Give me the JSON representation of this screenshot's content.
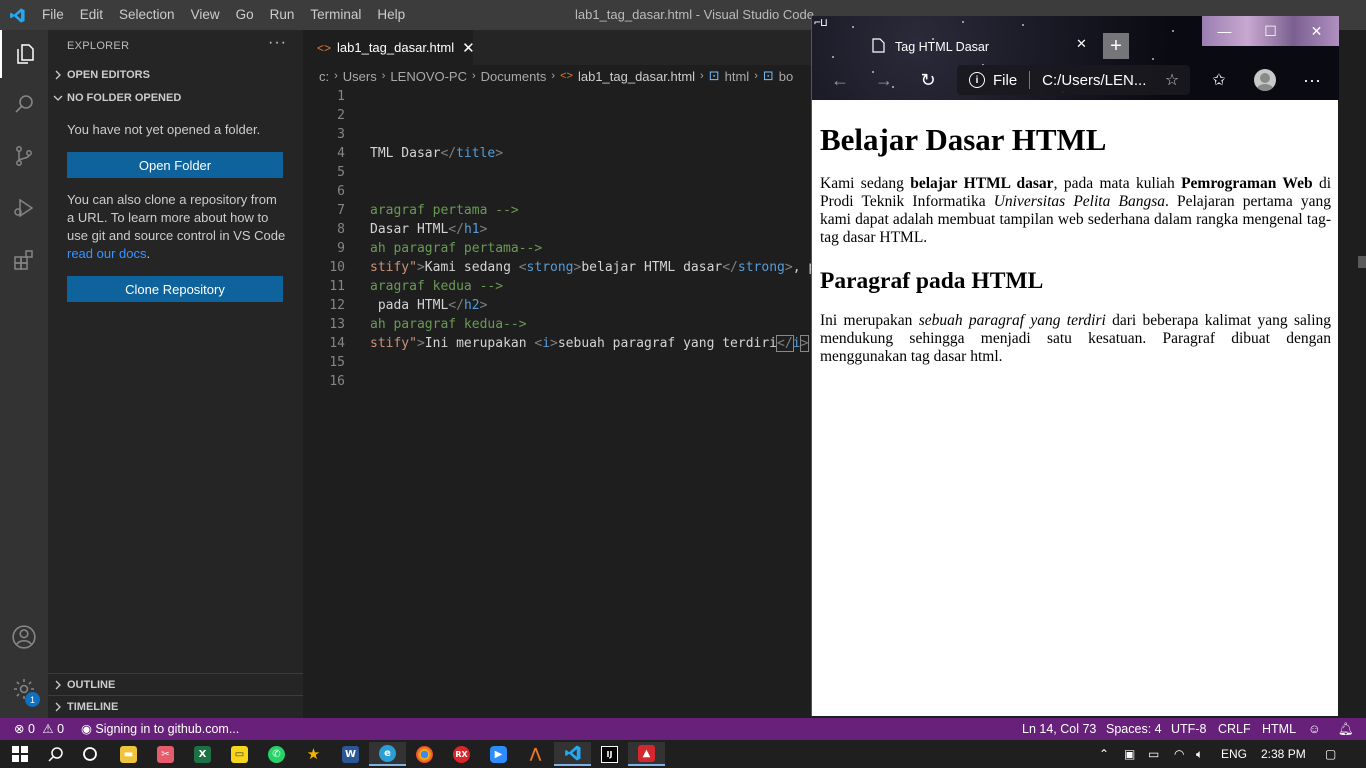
{
  "titlebar": {
    "menu": [
      "File",
      "Edit",
      "Selection",
      "View",
      "Go",
      "Run",
      "Terminal",
      "Help"
    ],
    "window_title": "lab1_tag_dasar.html - Visual Studio Code"
  },
  "activitybar": {
    "items": [
      "explorer-icon",
      "search-icon",
      "source-control-icon",
      "run-debug-icon",
      "extensions-icon",
      "accounts-icon",
      "manage-gear-icon"
    ],
    "badge": "1"
  },
  "sidebar": {
    "title": "EXPLORER",
    "more": "···",
    "open_editors": "OPEN EDITORS",
    "no_folder": "NO FOLDER OPENED",
    "no_folder_text": "You have not yet opened a folder.",
    "open_folder_button": "Open Folder",
    "clone_text_before": "You can also clone a repository from a URL. To learn more about how to use git and source control in VS Code ",
    "clone_link": "read our docs",
    "clone_text_after": ".",
    "clone_button": "Clone Repository",
    "outline": "OUTLINE",
    "timeline": "TIMELINE"
  },
  "editor": {
    "tab_label": "lab1_tag_dasar.html",
    "tab_close": "✕",
    "breadcrumbs": [
      "c:",
      "Users",
      "LENOVO-PC",
      "Documents",
      "lab1_tag_dasar.html",
      "html",
      "bo"
    ],
    "line_numbers": [
      "1",
      "2",
      "3",
      "4",
      "5",
      "6",
      "7",
      "8",
      "9",
      "10",
      "11",
      "12",
      "13",
      "14",
      "15",
      "16"
    ]
  },
  "browser": {
    "tab_title": "Tag HTML Dasar",
    "tab_close": "✕",
    "new_tab": "+",
    "address_scheme": "File",
    "address_url": "C:/Users/LEN...",
    "window_buttons": [
      "—",
      "☐",
      "✕"
    ],
    "page": {
      "h1": "Belajar Dasar HTML",
      "p1_a": "Kami sedang ",
      "p1_strong1": "belajar HTML dasar",
      "p1_b": ", pada mata kuliah ",
      "p1_strong2": "Pemrograman Web",
      "p1_c": " di Prodi Teknik Informatika ",
      "p1_em": "Universitas Pelita Bangsa",
      "p1_d": ". Pelajaran pertama yang kami dapat adalah membuat tampilan web sederhana dalam rangka mengenal tag-tag dasar HTML.",
      "h2": "Paragraf pada HTML",
      "p2_a": "Ini merupakan ",
      "p2_em": "sebuah paragraf yang terdiri",
      "p2_b": " dari beberapa kalimat yang saling mendukung sehingga menjadi satu kesatuan. Paragraf dibuat dengan menggunakan tag dasar html."
    }
  },
  "statusbar": {
    "errors": "0",
    "warnings": "0",
    "signin": "Signing in to github.com...",
    "position": "Ln 14, Col 73",
    "spaces": "Spaces: 4",
    "encoding": "UTF-8",
    "eol": "CRLF",
    "language": "HTML"
  },
  "taskbar": {
    "language": "ENG",
    "time": "2:38 PM",
    "apps": [
      "file-explorer",
      "snipping",
      "excel",
      "sticky-notes",
      "whatsapp",
      "starred",
      "word",
      "edge",
      "chrome",
      "rx",
      "zoom",
      "matlab",
      "vscode",
      "intellij",
      "acrobat"
    ]
  }
}
